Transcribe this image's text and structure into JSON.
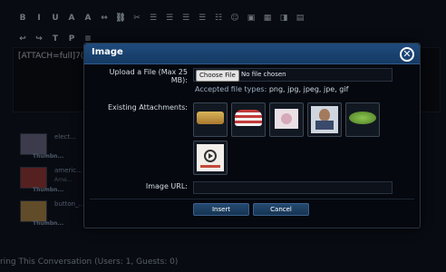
{
  "editor": {
    "toolbar_row1": [
      "B",
      "I",
      "U",
      "A",
      "A",
      "↔",
      "⛓",
      "✂",
      "☰",
      "☰",
      "☰",
      "☰",
      "☷",
      "☺",
      "▣",
      "▦",
      "◨",
      "▤"
    ],
    "toolbar_row2": [
      "↩",
      "↪",
      "T",
      "P",
      "≡"
    ],
    "content": "[ATTACH=full]7(%",
    "attachments": [
      {
        "title": "elect...",
        "sub": "",
        "link": "Thumbn..."
      },
      {
        "title": "americ...",
        "sub": "Ame...",
        "link": "Thumbn..."
      },
      {
        "title": "button_...",
        "sub": "",
        "link": "Thumbn..."
      }
    ]
  },
  "footer": {
    "text": "ring This Conversation (Users: 1, Guests: 0)"
  },
  "modal": {
    "title": "Image",
    "close_label": "✕",
    "upload_label": "Upload a File (Max 25 MB):",
    "choose_file_label": "Choose File",
    "no_file_text": "No file chosen",
    "accepted_prefix": "Accepted file types: ",
    "accepted_types": "png, jpg, jpeg, jpe, gif",
    "existing_label": "Existing Attachments:",
    "attachments": [
      {
        "name": "attachment-bread",
        "color": "#c9a24a"
      },
      {
        "name": "attachment-flag-hat",
        "color": "#b03a3a"
      },
      {
        "name": "attachment-anime",
        "color": "#d6b8c4"
      },
      {
        "name": "attachment-portrait",
        "color": "#8a6a52"
      },
      {
        "name": "attachment-greens",
        "color": "#6fa03a"
      },
      {
        "name": "attachment-video-button",
        "color": "#e8e4e0"
      }
    ],
    "image_url_label": "Image URL:",
    "image_url_value": "",
    "insert_label": "Insert",
    "cancel_label": "Cancel"
  },
  "colors": {
    "header": "#1f4b7d",
    "accent": "#2e5c91",
    "background": "#080b12"
  }
}
